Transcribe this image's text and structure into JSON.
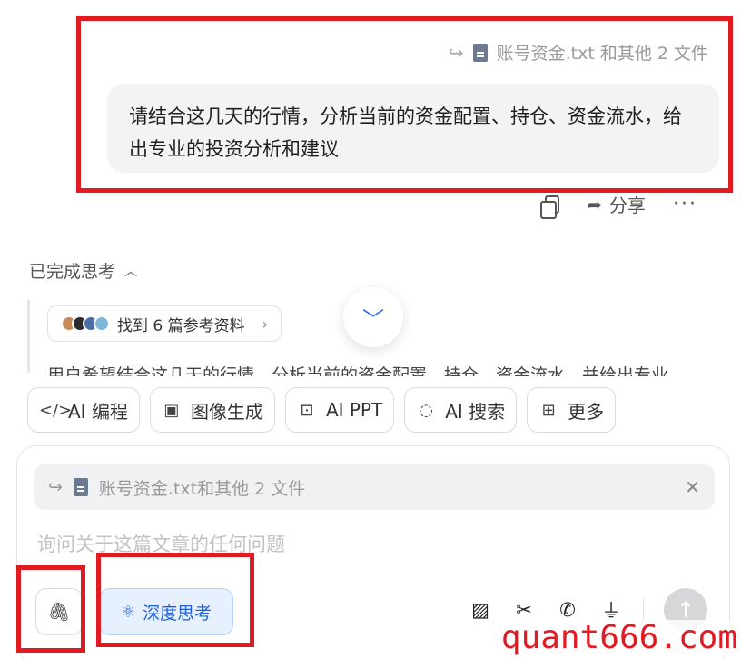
{
  "message": {
    "attachment_label": "账号资金.txt 和其他 2 文件",
    "text": "请结合这几天的行情，分析当前的资金配置、持仓、资金流水，给出专业的投资分析和建议"
  },
  "actions": {
    "share_label": "分享",
    "more_label": "···"
  },
  "thinking": {
    "title": "已完成思考",
    "refs_label": "找到 6 篇参考资料",
    "faded_text": "用户希望结合这几天的行情，分析当前的资金配置、持仓、资金流水，并给出专业"
  },
  "tools": [
    {
      "icon": "code-icon",
      "glyph": "</>",
      "label": "AI 编程"
    },
    {
      "icon": "image-gen-icon",
      "glyph": "▣",
      "label": "图像生成"
    },
    {
      "icon": "ppt-icon",
      "glyph": "⊡",
      "label": "AI PPT"
    },
    {
      "icon": "ai-search-icon",
      "glyph": "◌",
      "label": "AI 搜索"
    },
    {
      "icon": "more-grid-icon",
      "glyph": "⊞",
      "label": "更多"
    }
  ],
  "composer": {
    "ref_label": "账号资金.txt和其他 2 文件",
    "placeholder": "询问关于这篇文章的任何问题",
    "deep_think_label": "深度思考"
  },
  "watermark": "quant666.com",
  "colors": {
    "highlight": "#e21b23",
    "accent": "#1f5fd6",
    "bubble": "#f3f3f4"
  }
}
